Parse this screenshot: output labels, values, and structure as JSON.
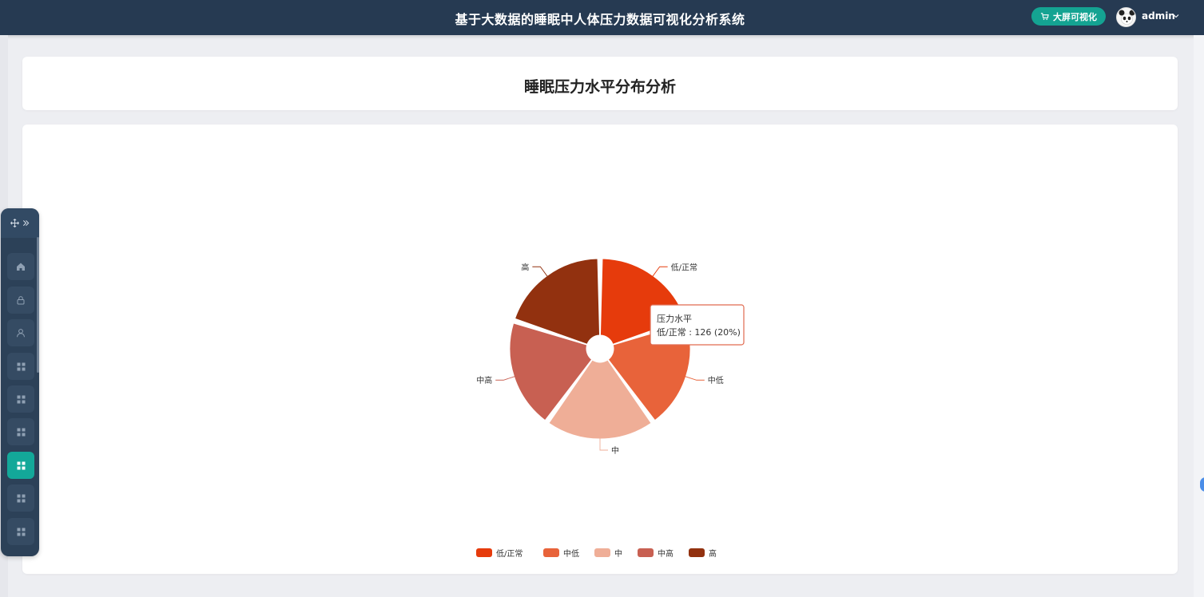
{
  "header": {
    "title": "基于大数据的睡眠中人体压力数据可视化分析系统",
    "bigscreen_label": "大屏可视化",
    "username": "admin"
  },
  "page": {
    "title": "睡眠压力水平分布分析"
  },
  "menu": {
    "items": [
      {
        "icon": "home-icon"
      },
      {
        "icon": "lock-icon"
      },
      {
        "icon": "user-icon"
      },
      {
        "icon": "grid-icon"
      },
      {
        "icon": "grid-icon"
      },
      {
        "icon": "grid-icon"
      },
      {
        "icon": "grid-icon",
        "active": true
      },
      {
        "icon": "grid-icon"
      },
      {
        "icon": "grid-icon"
      }
    ]
  },
  "colors": {
    "header_bg": "#263a52",
    "accent": "#13a899",
    "slices": [
      "#e63b0c",
      "#e8633a",
      "#efae97",
      "#c86052",
      "#92310f"
    ]
  },
  "tooltip": {
    "title": "压力水平",
    "text": "低/正常 : 126 (20%)"
  },
  "chart_data": {
    "type": "pie",
    "variant": "rose",
    "series_name": "压力水平",
    "categories": [
      "低/正常",
      "中低",
      "中",
      "中高",
      "高"
    ],
    "values": [
      126,
      126,
      126,
      126,
      126
    ],
    "legend_position": "bottom"
  }
}
